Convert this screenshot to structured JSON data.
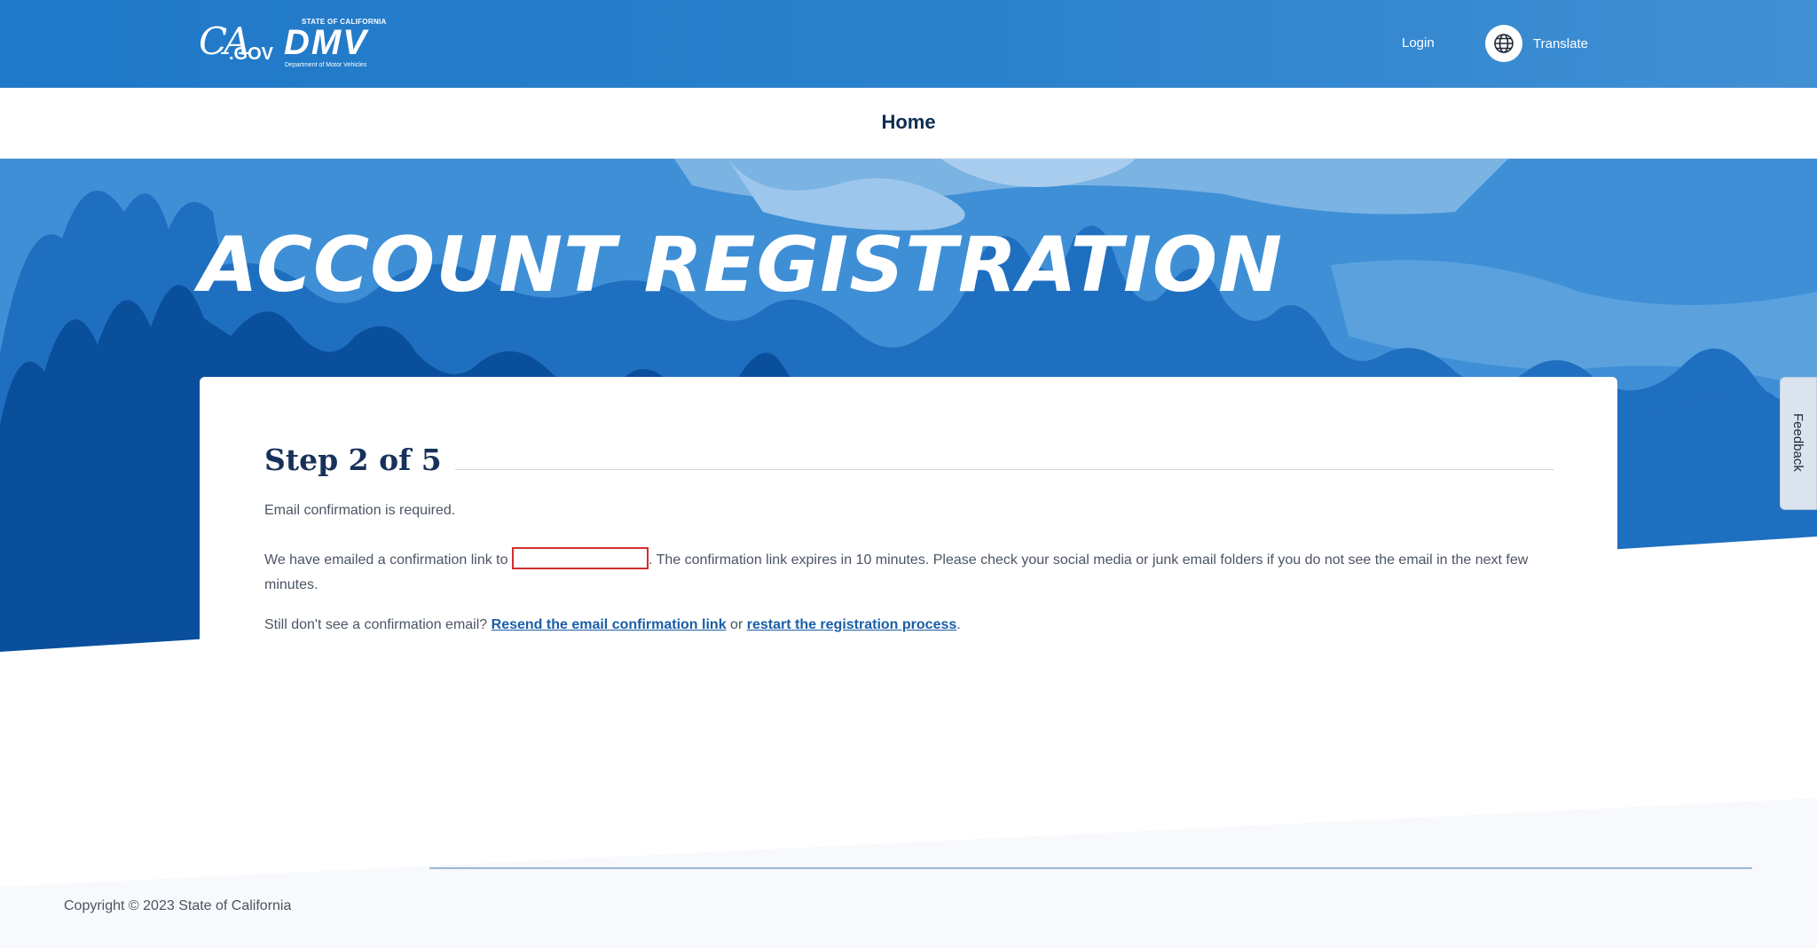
{
  "header": {
    "ca_gov_logo": {
      "ca": "CA",
      "gov": ".GOV"
    },
    "dmv_logo": {
      "state": "STATE OF CALIFORNIA",
      "name": "DMV",
      "department": "Department of Motor Vehicles"
    },
    "login_label": "Login",
    "translate_label": "Translate",
    "translate_icon": "globe-icon"
  },
  "nav": {
    "home_label": "Home"
  },
  "hero": {
    "title": "ACCOUNT REGISTRATION"
  },
  "card": {
    "step_title": "Step 2 of 5",
    "required_text": "Email confirmation is required.",
    "emailed_prefix": "We have emailed a confirmation link to",
    "emailed_suffix": ". The confirmation link expires in 10 minutes. Please check your social media or junk email folders if you do not see the email in the next few minutes.",
    "still_text": "Still don't see a confirmation email?",
    "resend_link": "Resend the email confirmation link",
    "or_text": "or",
    "restart_link": "restart the registration process",
    "period": "."
  },
  "feedback_label": "Feedback",
  "footer": {
    "copyright": "Copyright © 2023 State of California"
  },
  "colors": {
    "header_blue": "#1f78c8",
    "hero_dark": "#0a4f9c",
    "link": "#1a5ea8",
    "title_navy": "#17325a"
  }
}
